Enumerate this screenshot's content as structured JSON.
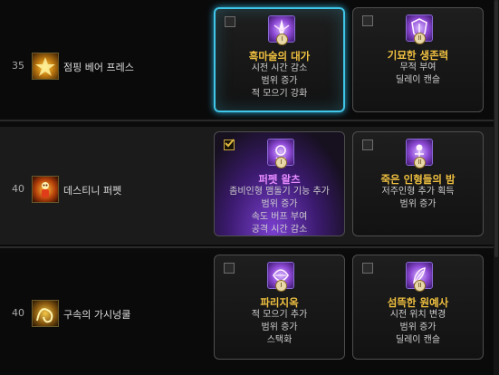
{
  "rows": [
    {
      "level": "35",
      "skill_name": "점핑 베어 프레스",
      "icon": "jumping-bear-icon",
      "options": [
        {
          "numeral": "I",
          "title": "흑마술의 대가",
          "lines": [
            "시전 시간 감소",
            "범위 증가",
            "적 모으기 강화"
          ],
          "selected": true,
          "checked": false,
          "title_color": "#f0c040"
        },
        {
          "numeral": "II",
          "title": "기묘한 생존력",
          "lines": [
            "무적 부여",
            "딜레이 캔슬"
          ],
          "selected": false,
          "checked": false,
          "title_color": "#f0c040"
        }
      ]
    },
    {
      "level": "40",
      "skill_name": "데스티니 퍼펫",
      "icon": "destiny-puppet-icon",
      "options": [
        {
          "numeral": "I",
          "title": "퍼펫 왈츠",
          "lines": [
            "좀비인형 맴돌기 기능 추가",
            "범위 증가",
            "속도 버프 부여",
            "공격 시간 감소"
          ],
          "selected": false,
          "checked": true,
          "title_color": "#e68bff"
        },
        {
          "numeral": "II",
          "title": "죽은 인형들의 밤",
          "lines": [
            "저주인형 추가 획득",
            "범위 증가"
          ],
          "selected": false,
          "checked": false,
          "title_color": "#f0c040"
        }
      ]
    },
    {
      "level": "40",
      "skill_name": "구속의 가시넝쿨",
      "icon": "thorn-vine-icon",
      "options": [
        {
          "numeral": "I",
          "title": "파리지옥",
          "lines": [
            "적 모으기 추가",
            "범위 증가",
            "스택화"
          ],
          "selected": false,
          "checked": false,
          "title_color": "#f0c040"
        },
        {
          "numeral": "II",
          "title": "섬뜩한 원예사",
          "lines": [
            "시전 위치 변경",
            "범위 증가",
            "딜레이 캔슬"
          ],
          "selected": false,
          "checked": false,
          "title_color": "#f0c040"
        }
      ]
    }
  ]
}
